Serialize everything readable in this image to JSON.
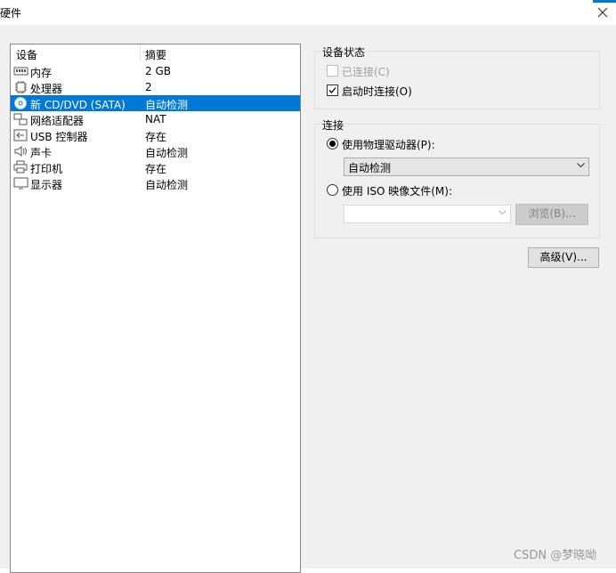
{
  "window": {
    "title": "硬件"
  },
  "device_list": {
    "columns": {
      "device": "设备",
      "summary": "摘要"
    },
    "rows": [
      {
        "name": "内存",
        "summary": "2 GB",
        "icon": "memory-icon"
      },
      {
        "name": "处理器",
        "summary": "2",
        "icon": "processor-icon"
      },
      {
        "name": "新 CD/DVD (SATA)",
        "summary": "自动检测",
        "icon": "cd-dvd-icon",
        "selected": true
      },
      {
        "name": "网络适配器",
        "summary": "NAT",
        "icon": "network-adapter-icon"
      },
      {
        "name": "USB 控制器",
        "summary": "存在",
        "icon": "usb-controller-icon"
      },
      {
        "name": "声卡",
        "summary": "自动检测",
        "icon": "sound-card-icon"
      },
      {
        "name": "打印机",
        "summary": "存在",
        "icon": "printer-icon"
      },
      {
        "name": "显示器",
        "summary": "自动检测",
        "icon": "display-icon"
      }
    ]
  },
  "device_status": {
    "legend": "设备状态",
    "connected": {
      "label": "已连接(C)",
      "checked": false,
      "disabled": true
    },
    "connect_at_power_on": {
      "label": "启动时连接(O)",
      "checked": true
    }
  },
  "connection": {
    "legend": "连接",
    "physical_drive": {
      "label": "使用物理驱动器(P):",
      "selected": true,
      "value": "自动检测"
    },
    "iso_image": {
      "label": "使用 ISO 映像文件(M):",
      "selected": false,
      "value": "",
      "browse_label": "浏览(B)..."
    }
  },
  "advanced_button": {
    "label": "高级(V)..."
  },
  "watermark": "CSDN @梦晓呦",
  "colors": {
    "selection": "#0078d7",
    "dialog_bg": "#f0f0f0"
  }
}
